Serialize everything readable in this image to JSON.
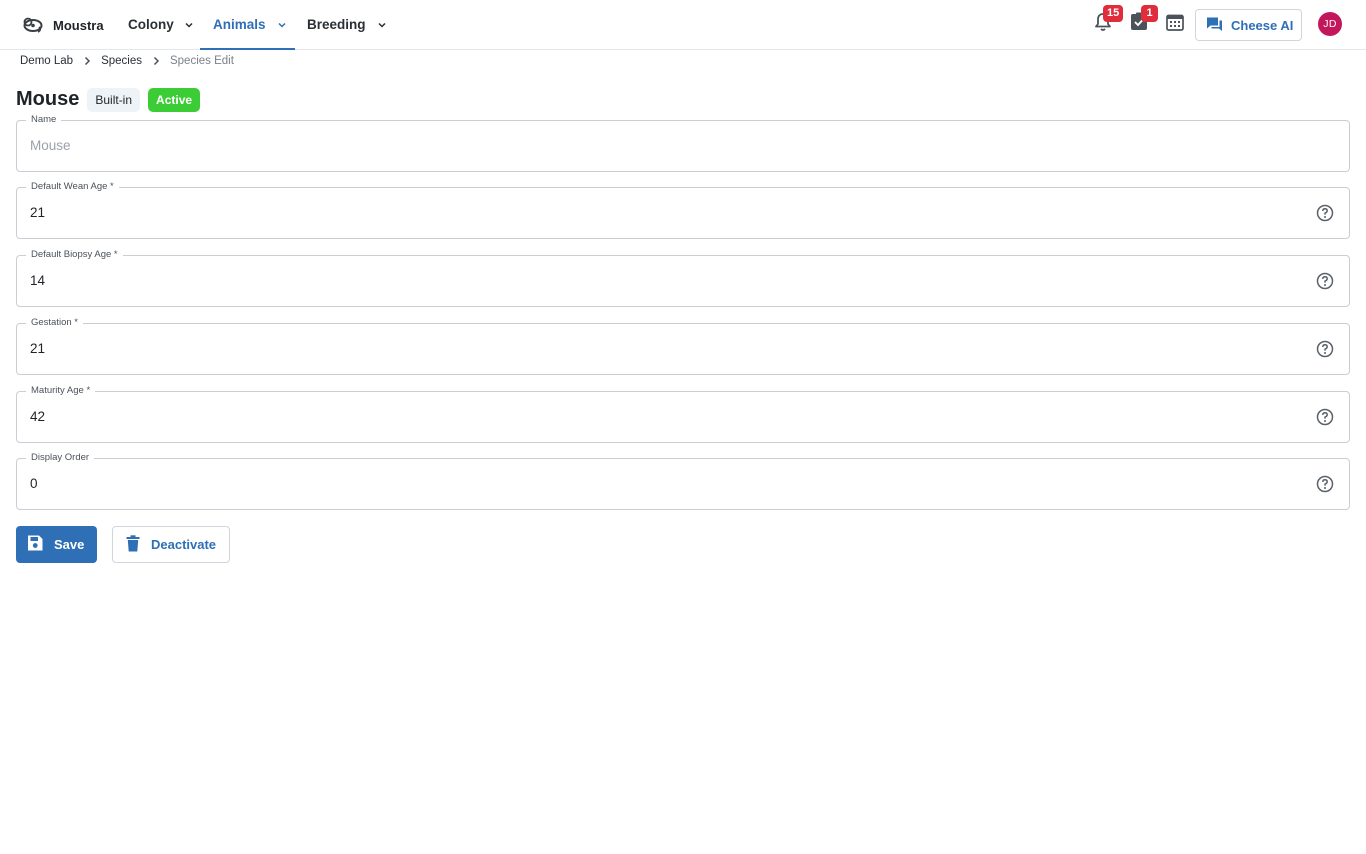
{
  "app": {
    "name": "Moustra"
  },
  "nav": {
    "items": [
      {
        "label": "Colony",
        "active": false
      },
      {
        "label": "Animals",
        "active": true
      },
      {
        "label": "Breeding",
        "active": false
      }
    ]
  },
  "header": {
    "notifications_count": "15",
    "tasks_count": "1",
    "ai_button_label": "Cheese AI",
    "user_initials": "JD"
  },
  "breadcrumb": [
    "Demo Lab",
    "Species",
    "Species Edit"
  ],
  "page": {
    "title": "Mouse",
    "tags": [
      "Built-in",
      "Active"
    ]
  },
  "form": {
    "fields": [
      {
        "label": "Name",
        "placeholder": "Mouse",
        "value": "",
        "disabled": true
      },
      {
        "label": "Default Wean Age *",
        "value": "21"
      },
      {
        "label": "Default Biopsy Age *",
        "value": "14"
      },
      {
        "label": "Gestation *",
        "value": "21"
      },
      {
        "label": "Maturity Age *",
        "value": "42"
      },
      {
        "label": "Display Order",
        "value": "0"
      }
    ],
    "save_label": "Save",
    "deactivate_label": "Deactivate"
  },
  "colors": {
    "primary": "#2f6fb5",
    "active_tag": "#3ccc36",
    "badge": "#e02d3c",
    "avatar": "#c2185b"
  },
  "icons": [
    "moustra-logo-icon",
    "chevron-down-icon",
    "bell-icon",
    "task-check-icon",
    "calendar-icon",
    "chat-icon",
    "chevron-right-icon",
    "help-circle-icon",
    "save-disk-icon",
    "trash-icon"
  ]
}
